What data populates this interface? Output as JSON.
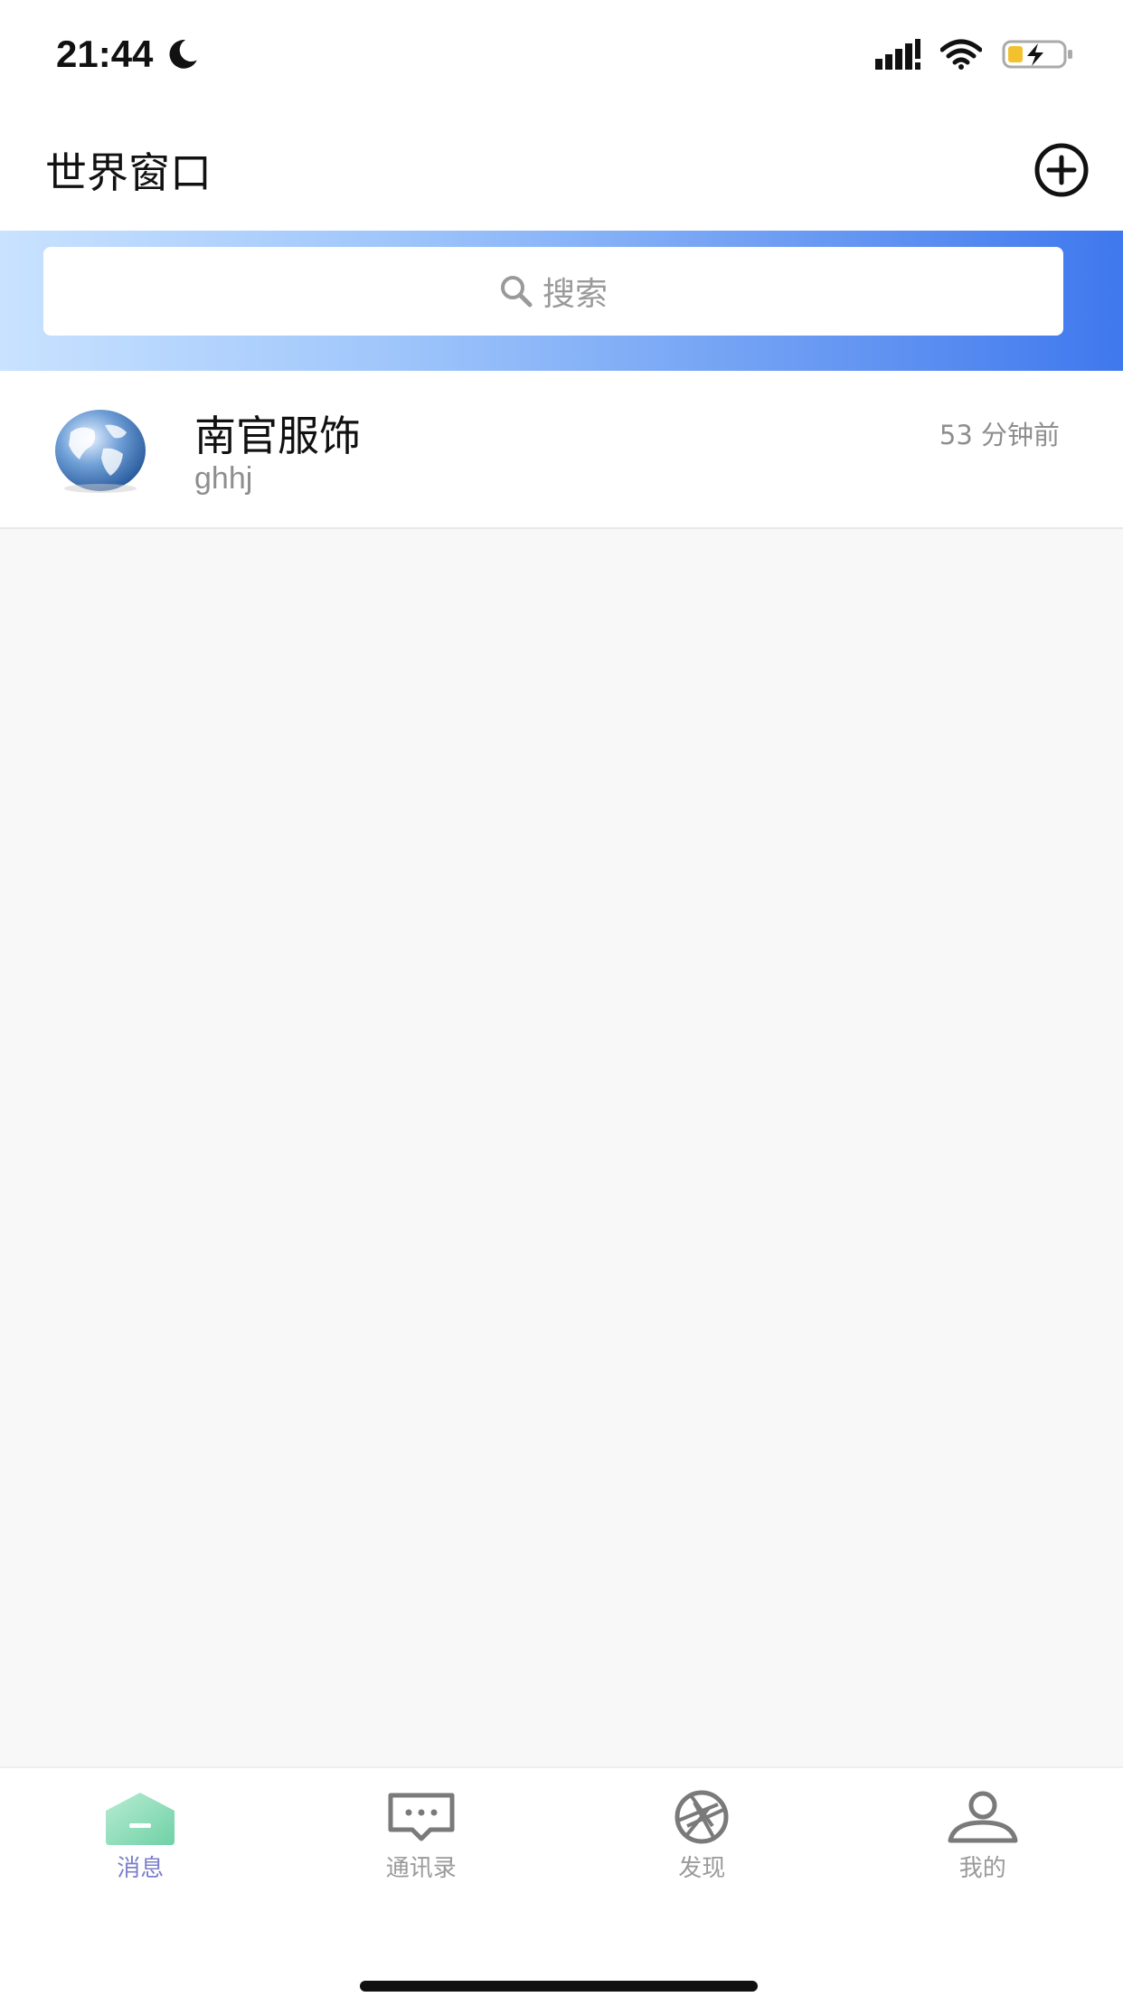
{
  "status_bar": {
    "time": "21:44",
    "icons": [
      "moon-icon",
      "signal-icon",
      "wifi-icon",
      "battery-charging-icon"
    ]
  },
  "header": {
    "title": "世界窗口",
    "add_icon": "plus-circle-icon"
  },
  "search": {
    "placeholder": "搜索",
    "icon": "search-icon"
  },
  "conversations": [
    {
      "name": "南官服饰",
      "preview": "ghhj",
      "time": "53 分钟前",
      "avatar": "globe-avatar"
    }
  ],
  "tabs": [
    {
      "label": "消息",
      "icon": "home-icon",
      "active": true
    },
    {
      "label": "通讯录",
      "icon": "chat-bubble-icon",
      "active": false
    },
    {
      "label": "发现",
      "icon": "aperture-icon",
      "active": false
    },
    {
      "label": "我的",
      "icon": "person-icon",
      "active": false
    }
  ],
  "colors": {
    "accent_active": "#7b7fc9",
    "banner_start": "#c9e2ff",
    "banner_end": "#3f78ee",
    "home_icon_green": "#8fdcb8"
  }
}
